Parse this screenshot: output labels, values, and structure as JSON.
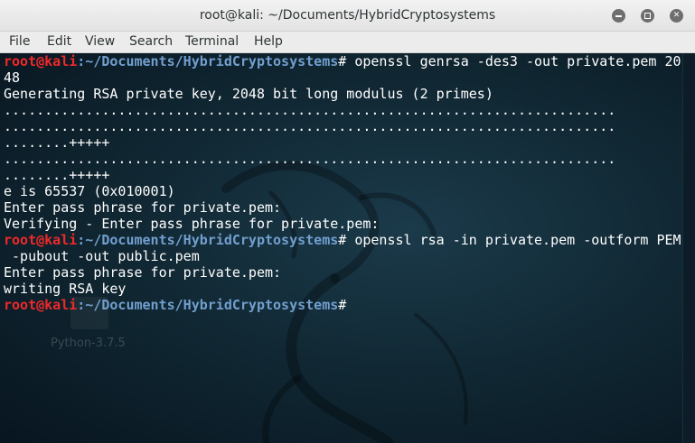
{
  "window": {
    "title": "root@kali: ~/Documents/HybridCryptosystems",
    "buttons": {
      "minimize": "minimize-icon",
      "maximize": "maximize-icon",
      "close": "close-icon"
    }
  },
  "menubar": {
    "items": [
      {
        "label": "File"
      },
      {
        "label": "Edit"
      },
      {
        "label": "View"
      },
      {
        "label": "Search"
      },
      {
        "label": "Terminal"
      },
      {
        "label": "Help"
      }
    ]
  },
  "terminal": {
    "user": "root@kali",
    "path": ":~/Documents/HybridCryptosystems",
    "lines": [
      {
        "type": "prompt",
        "cmd": "# openssl genrsa -des3 -out private.pem 20"
      },
      {
        "type": "text",
        "text": "48"
      },
      {
        "type": "text",
        "text": "Generating RSA private key, 2048 bit long modulus (2 primes)"
      },
      {
        "type": "text",
        "text": "..........................................................................."
      },
      {
        "type": "text",
        "text": "..........................................................................."
      },
      {
        "type": "text",
        "text": "........+++++"
      },
      {
        "type": "text",
        "text": "..........................................................................."
      },
      {
        "type": "text",
        "text": "........+++++"
      },
      {
        "type": "text",
        "text": "e is 65537 (0x010001)"
      },
      {
        "type": "text",
        "text": "Enter pass phrase for private.pem:"
      },
      {
        "type": "text",
        "text": "Verifying - Enter pass phrase for private.pem:"
      },
      {
        "type": "prompt",
        "cmd": "# openssl rsa -in private.pem -outform PEM"
      },
      {
        "type": "text",
        "text": " -pubout -out public.pem"
      },
      {
        "type": "text",
        "text": "Enter pass phrase for private.pem:"
      },
      {
        "type": "text",
        "text": "writing RSA key"
      },
      {
        "type": "prompt",
        "cmd": "#"
      }
    ]
  },
  "desktop_icon": {
    "label": "Python-3.7.5"
  }
}
